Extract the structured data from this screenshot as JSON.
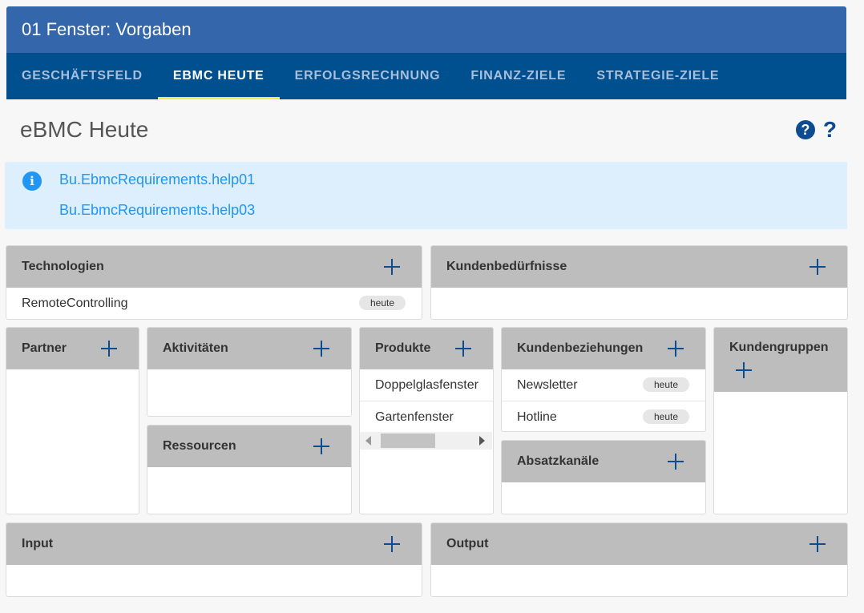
{
  "window": {
    "title": "01 Fenster: Vorgaben"
  },
  "tabs": [
    {
      "label": "GESCHÄFTSFELD"
    },
    {
      "label": "EBMC HEUTE"
    },
    {
      "label": "ERFOLGSRECHNUNG"
    },
    {
      "label": "FINANZ-ZIELE"
    },
    {
      "label": "STRATEGIE-ZIELE"
    }
  ],
  "active_tab": "EBMC HEUTE",
  "page": {
    "title": "eBMC Heute",
    "help_icons": [
      "help-circle-icon",
      "help-question-icon"
    ]
  },
  "info": {
    "icon": "info-icon",
    "lines": [
      "Bu.EbmcRequirements.help01",
      "Bu.EbmcRequirements.help03"
    ]
  },
  "cards": {
    "technologien": {
      "title": "Technologien",
      "items": [
        {
          "label": "RemoteControlling",
          "badge": "heute"
        }
      ]
    },
    "kundenbeduerfnisse": {
      "title": "Kundenbedürfnisse",
      "items": []
    },
    "partner": {
      "title": "Partner",
      "items": []
    },
    "aktivitaeten": {
      "title": "Aktivitäten",
      "items": []
    },
    "ressourcen": {
      "title": "Ressourcen",
      "items": []
    },
    "produkte": {
      "title": "Produkte",
      "items": [
        {
          "label": "Doppelglasfenster"
        },
        {
          "label": "Gartenfenster"
        }
      ]
    },
    "kundenbeziehungen": {
      "title": "Kundenbeziehungen",
      "items": [
        {
          "label": "Newsletter",
          "badge": "heute"
        },
        {
          "label": "Hotline",
          "badge": "heute"
        }
      ]
    },
    "absatzkanaele": {
      "title": "Absatzkanäle",
      "items": []
    },
    "kundengruppen": {
      "title": "Kundengruppen",
      "items": []
    },
    "input": {
      "title": "Input",
      "items": []
    },
    "output": {
      "title": "Output",
      "items": []
    }
  },
  "colors": {
    "title_bar": "#3366aa",
    "tab_bar": "#00508f",
    "tab_indicator": "#f2e85c",
    "card_header": "#bdbdbd",
    "accent": "#0d4d8f",
    "info_bg": "#ddeefc",
    "info_text": "#2196f3"
  }
}
